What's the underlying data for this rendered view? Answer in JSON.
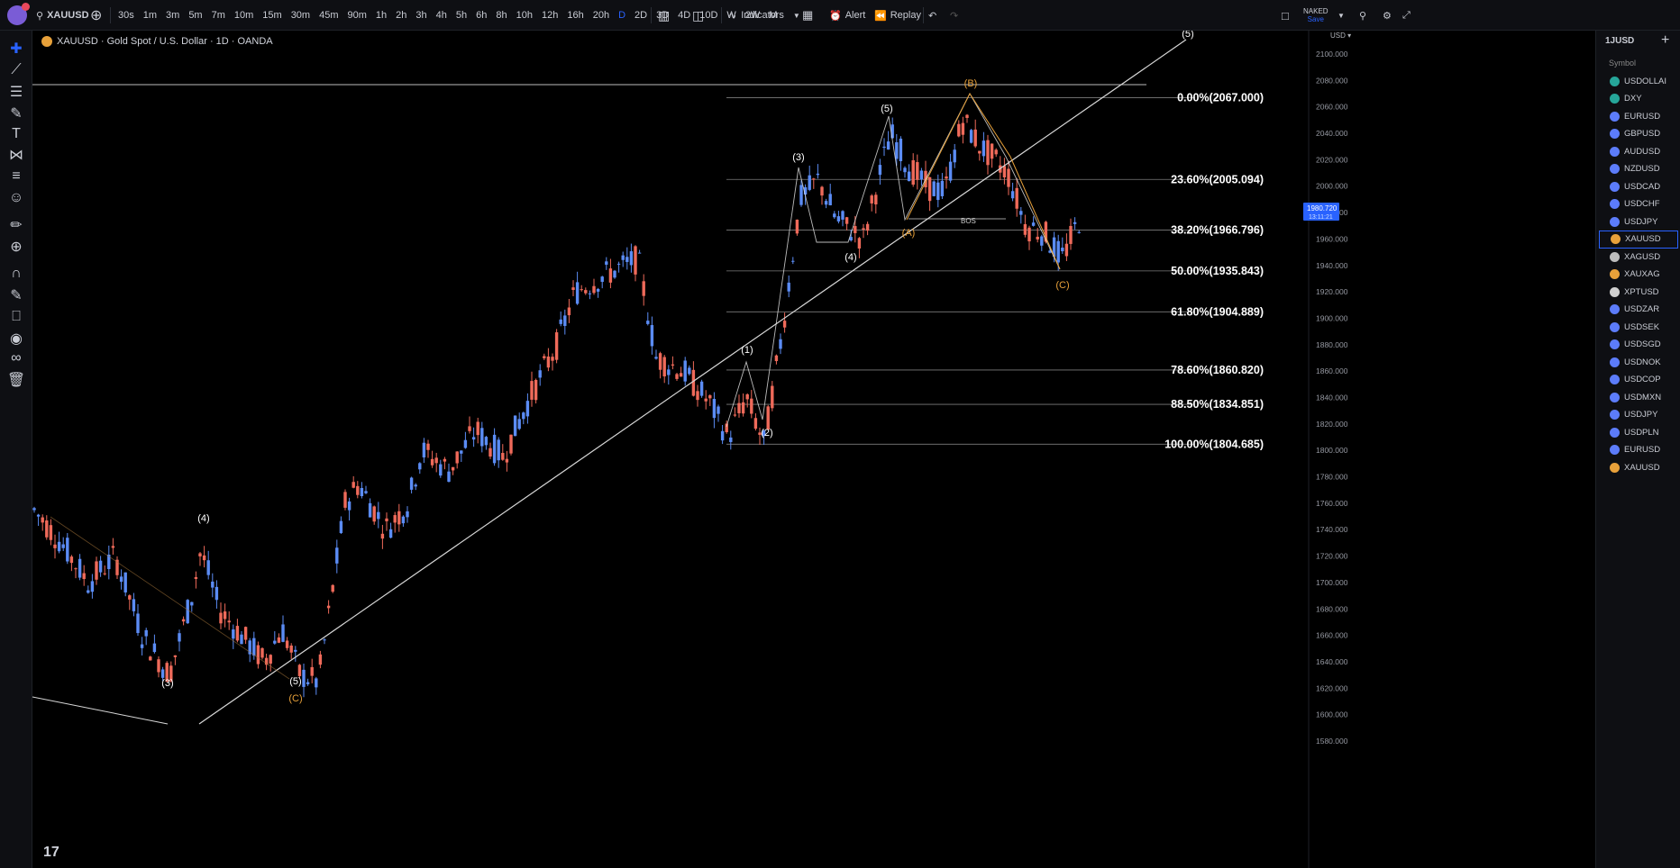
{
  "topbar": {
    "symbol": "XAUUSD",
    "intervals": [
      "30s",
      "1m",
      "3m",
      "5m",
      "7m",
      "10m",
      "15m",
      "30m",
      "45m",
      "90m",
      "1h",
      "2h",
      "3h",
      "4h",
      "5h",
      "6h",
      "8h",
      "10h",
      "12h",
      "16h",
      "20h",
      "D",
      "2D",
      "3D",
      "4D",
      "10D",
      "W",
      "2W",
      "M"
    ],
    "active_interval": "D",
    "indicators_label": "Indicators",
    "alert_label": "Alert",
    "replay_label": "Replay",
    "layout_name": "NAKED",
    "layout_sub": "Save"
  },
  "legend": {
    "text": "XAUUSD · Gold Spot / U.S. Dollar · 1D · OANDA"
  },
  "price_axis": {
    "currency": "USD",
    "labels": [
      "2100.000",
      "2080.000",
      "2060.000",
      "2040.000",
      "2020.000",
      "2000.000",
      "1980.000",
      "1960.000",
      "1940.000",
      "1920.000",
      "1900.000",
      "1880.000",
      "1860.000",
      "1840.000",
      "1820.000",
      "1800.000",
      "1780.000",
      "1760.000",
      "1740.000",
      "1720.000",
      "1700.000",
      "1680.000",
      "1660.000",
      "1640.000",
      "1620.000",
      "1600.000",
      "1580.000"
    ],
    "current_price": "1980.720",
    "current_timer": "13:11:21"
  },
  "fib_levels": [
    {
      "label": "0.00%(2067.000)",
      "price": 2067.0
    },
    {
      "label": "23.60%(2005.094)",
      "price": 2005.094
    },
    {
      "label": "38.20%(1966.796)",
      "price": 1966.796
    },
    {
      "label": "50.00%(1935.843)",
      "price": 1935.843
    },
    {
      "label": "61.80%(1904.889)",
      "price": 1904.889
    },
    {
      "label": "78.60%(1860.820)",
      "price": 1860.82
    },
    {
      "label": "88.50%(1834.851)",
      "price": 1834.851
    },
    {
      "label": "100.00%(1804.685)",
      "price": 1804.685
    }
  ],
  "wave_labels": [
    {
      "text": "(3)",
      "color": "#ffffff"
    },
    {
      "text": "(4)",
      "color": "#ffffff"
    },
    {
      "text": "(5)",
      "color": "#ffffff"
    },
    {
      "text": "(C)",
      "color": "#e8a13a"
    },
    {
      "text": "(1)",
      "color": "#ffffff"
    },
    {
      "text": "(2)",
      "color": "#ffffff"
    },
    {
      "text": "(3)",
      "color": "#ffffff"
    },
    {
      "text": "(4)",
      "color": "#ffffff"
    },
    {
      "text": "(5)",
      "color": "#ffffff"
    },
    {
      "text": "(A)",
      "color": "#e8a13a"
    },
    {
      "text": "(B)",
      "color": "#e8a13a"
    },
    {
      "text": "(C)",
      "color": "#e8a13a"
    },
    {
      "text": "(5)",
      "color": "#ffffff"
    }
  ],
  "bos_label": "BOS",
  "watchlist": {
    "header": "1JUSD",
    "column": "Symbol",
    "items": [
      {
        "symbol": "USDOLLAI",
        "color": "#26a69a"
      },
      {
        "symbol": "DXY",
        "color": "#26a69a"
      },
      {
        "symbol": "EURUSD",
        "color": "#5c7cfa"
      },
      {
        "symbol": "GBPUSD",
        "color": "#5c7cfa"
      },
      {
        "symbol": "AUDUSD",
        "color": "#5c7cfa"
      },
      {
        "symbol": "NZDUSD",
        "color": "#5c7cfa"
      },
      {
        "symbol": "USDCAD",
        "color": "#5c7cfa"
      },
      {
        "symbol": "USDCHF",
        "color": "#5c7cfa"
      },
      {
        "symbol": "USDJPY",
        "color": "#5c7cfa"
      },
      {
        "symbol": "XAUUSD",
        "color": "#e8a13a"
      },
      {
        "symbol": "XAGUSD",
        "color": "#bdbdbd"
      },
      {
        "symbol": "XAUXAG",
        "color": "#e8a13a"
      },
      {
        "symbol": "XPTUSD",
        "color": "#d0d0d0"
      },
      {
        "symbol": "USDZAR",
        "color": "#5c7cfa"
      },
      {
        "symbol": "USDSEK",
        "color": "#5c7cfa"
      },
      {
        "symbol": "USDSGD",
        "color": "#5c7cfa"
      },
      {
        "symbol": "USDNOK",
        "color": "#5c7cfa"
      },
      {
        "symbol": "USDCOP",
        "color": "#5c7cfa"
      },
      {
        "symbol": "USDMXN",
        "color": "#5c7cfa"
      },
      {
        "symbol": "USDJPY",
        "color": "#5c7cfa"
      },
      {
        "symbol": "USDPLN",
        "color": "#5c7cfa"
      },
      {
        "symbol": "EURUSD",
        "color": "#5c7cfa"
      },
      {
        "symbol": "XAUUSD",
        "color": "#e8a13a"
      }
    ],
    "selected_index": 9
  },
  "colors": {
    "up": "#5b8cf5",
    "down": "#ef6a5a",
    "fib_line": "#9a9a9a",
    "trendline": "#d8d8d8",
    "wave_abc": "#e8a13a",
    "bg": "#000000"
  },
  "tv_logo": "17"
}
